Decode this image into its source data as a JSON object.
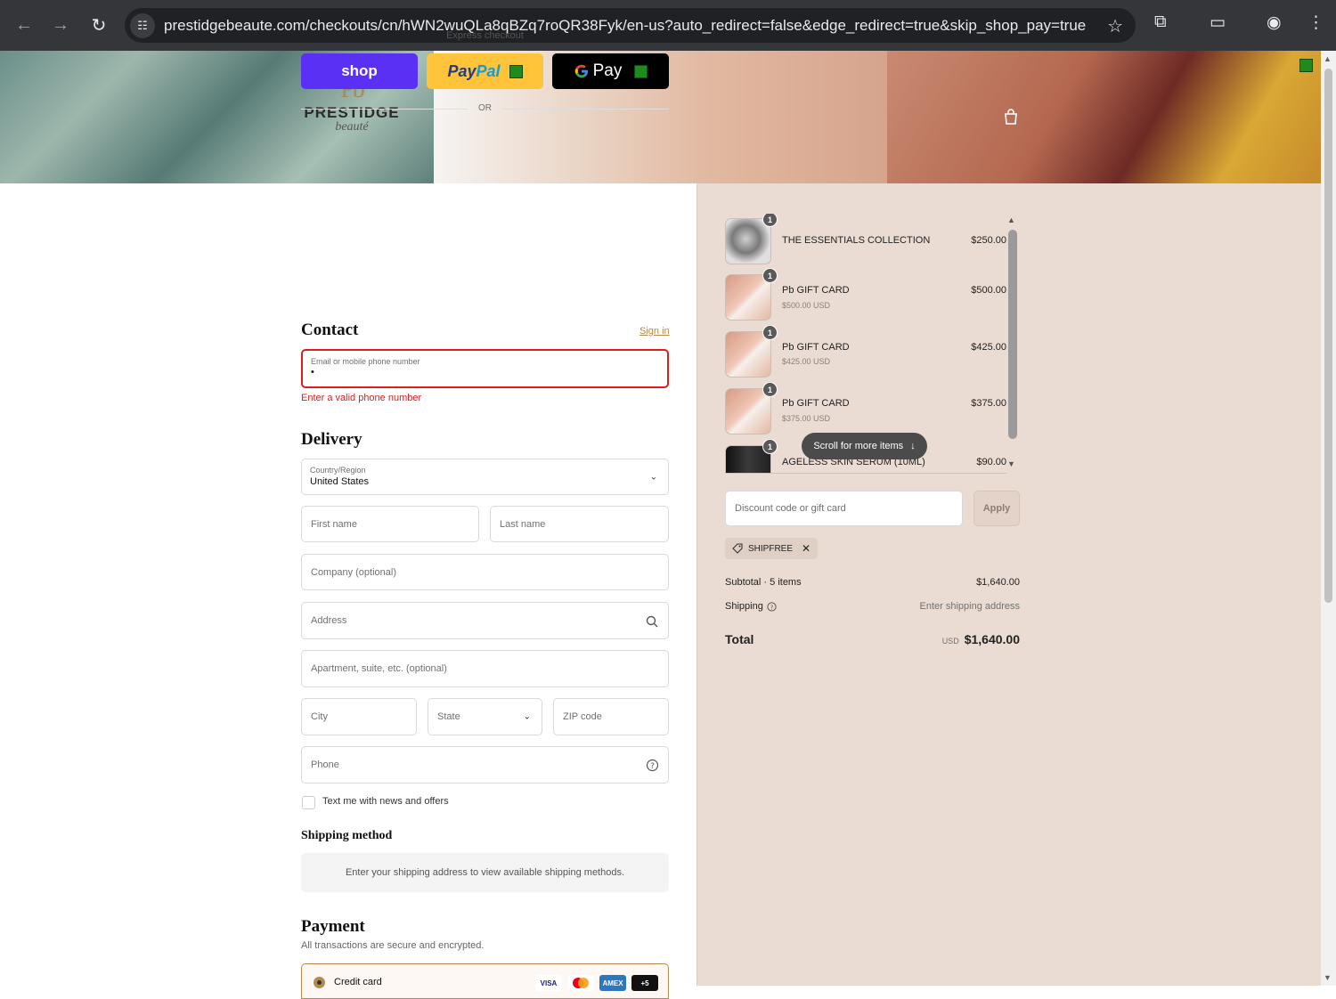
{
  "browser": {
    "url": "prestidgebeaute.com/checkouts/cn/hWN2wuQLa8qBZq7roQR38Fyk/en-us?auto_redirect=false&edge_redirect=true&skip_shop_pay=true"
  },
  "brand": {
    "name": "PRESTIDGE",
    "tagline": "beauté",
    "monogram": "Pb"
  },
  "express": {
    "label": "Express checkout",
    "shop_label": "shop",
    "paypal_pay": "Pay",
    "paypal_pal": "Pal",
    "gpay_label": "Pay",
    "or_label": "OR"
  },
  "contact": {
    "heading": "Contact",
    "signin": "Sign in",
    "email_label": "Email or mobile phone number",
    "email_value": "•",
    "error": "Enter a valid phone number"
  },
  "delivery": {
    "heading": "Delivery",
    "country_label": "Country/Region",
    "country_value": "United States",
    "first_name": "First name",
    "last_name": "Last name",
    "company": "Company (optional)",
    "address": "Address",
    "apartment": "Apartment, suite, etc. (optional)",
    "city": "City",
    "state": "State",
    "zip": "ZIP code",
    "phone": "Phone",
    "text_me": "Text me with news and offers"
  },
  "shipping_method": {
    "heading": "Shipping method",
    "message": "Enter your shipping address to view available shipping methods."
  },
  "payment": {
    "heading": "Payment",
    "subtitle": "All transactions are secure and encrypted.",
    "credit_card": "Credit card",
    "cards": [
      "VISA",
      "",
      "AMEX",
      "+5"
    ]
  },
  "cart": {
    "items": [
      {
        "name": "THE ESSENTIALS COLLECTION",
        "sub": "",
        "price": "$250.00",
        "qty": "1"
      },
      {
        "name": "Pb GIFT CARD",
        "sub": "$500.00 USD",
        "price": "$500.00",
        "qty": "1"
      },
      {
        "name": "Pb GIFT CARD",
        "sub": "$425.00 USD",
        "price": "$425.00",
        "qty": "1"
      },
      {
        "name": "Pb GIFT CARD",
        "sub": "$375.00 USD",
        "price": "$375.00",
        "qty": "1"
      },
      {
        "name": "AGELESS SKIN SERUM (10ML)",
        "sub": "",
        "price": "$90.00",
        "qty": "1"
      }
    ],
    "scroll_pill": "Scroll for more items",
    "discount_placeholder": "Discount code or gift card",
    "apply": "Apply",
    "applied_code": "SHIPFREE",
    "subtotal_label": "Subtotal · 5 items",
    "subtotal_value": "$1,640.00",
    "shipping_label": "Shipping",
    "shipping_value": "Enter shipping address",
    "total_label": "Total",
    "currency": "USD",
    "total_value": "$1,640.00"
  },
  "colors": {
    "shop_purple": "#5a31f4",
    "paypal_yellow": "#ffc439",
    "error_red": "#dd1d1d",
    "accent_gold": "#b58a4c",
    "summary_bg": "#ebdcd3"
  }
}
